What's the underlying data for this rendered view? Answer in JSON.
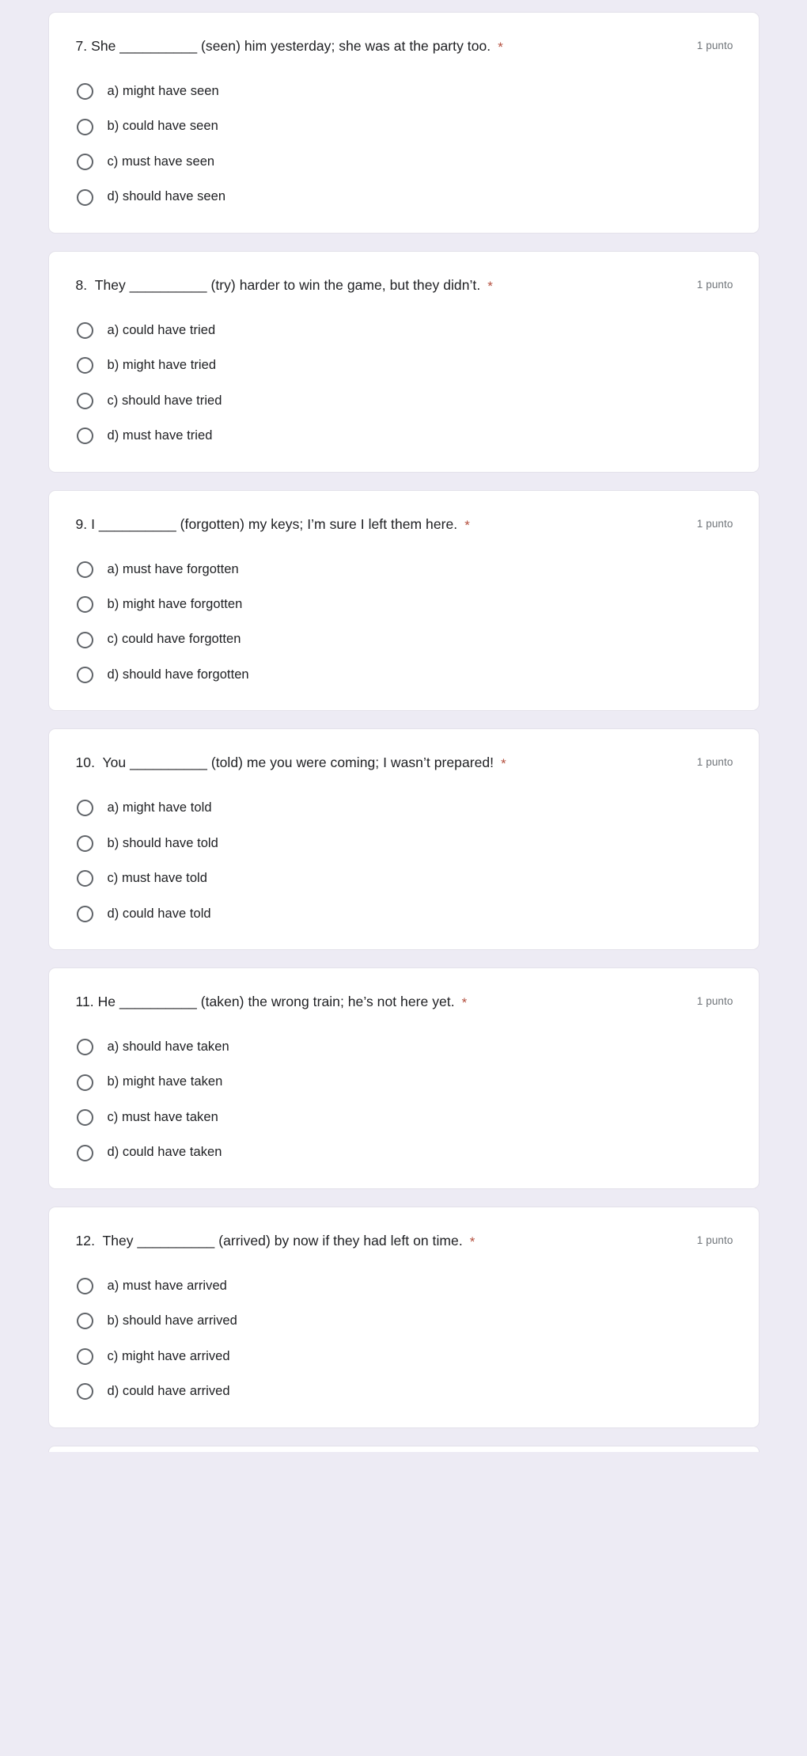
{
  "background_color": "#edebf4",
  "card_color": "#ffffff",
  "accent_required_color": "#b4503f",
  "points_text_color": "#70757a",
  "icons": {
    "radio_unselected": "radio-unselected-icon"
  },
  "questions": [
    {
      "title": "7. She __________ (seen) him yesterday; she was at the party too.",
      "required_marker": "*",
      "points": "1 punto",
      "options": [
        "a) might have seen",
        "b) could have seen",
        "c) must have seen",
        "d) should have seen"
      ]
    },
    {
      "title": "8.  They __________ (try) harder to win the game, but they didn’t.",
      "required_marker": "*",
      "points": "1 punto",
      "options": [
        "a) could have tried",
        "b) might have tried",
        "c) should have tried",
        "d) must have tried"
      ]
    },
    {
      "title": "9. I __________ (forgotten) my keys; I’m sure I left them here.",
      "required_marker": "*",
      "points": "1 punto",
      "options": [
        "a) must have forgotten",
        "b) might have forgotten",
        "c) could have forgotten",
        "d) should have forgotten"
      ]
    },
    {
      "title": "10.  You __________ (told) me you were coming; I wasn’t prepared!",
      "required_marker": "*",
      "points": "1 punto",
      "options": [
        "a) might have told",
        "b) should have told",
        "c) must have told",
        "d) could have told"
      ]
    },
    {
      "title": "11. He __________ (taken) the wrong train; he’s not here yet.",
      "required_marker": "*",
      "points": "1 punto",
      "options": [
        "a) should have taken",
        "b) might have taken",
        "c) must have taken",
        "d) could have taken"
      ]
    },
    {
      "title": "12.  They __________ (arrived) by now if they had left on time.",
      "required_marker": "*",
      "points": "1 punto",
      "options": [
        "a) must have arrived",
        "b) should have arrived",
        "c) might have arrived",
        "d) could have arrived"
      ]
    }
  ]
}
